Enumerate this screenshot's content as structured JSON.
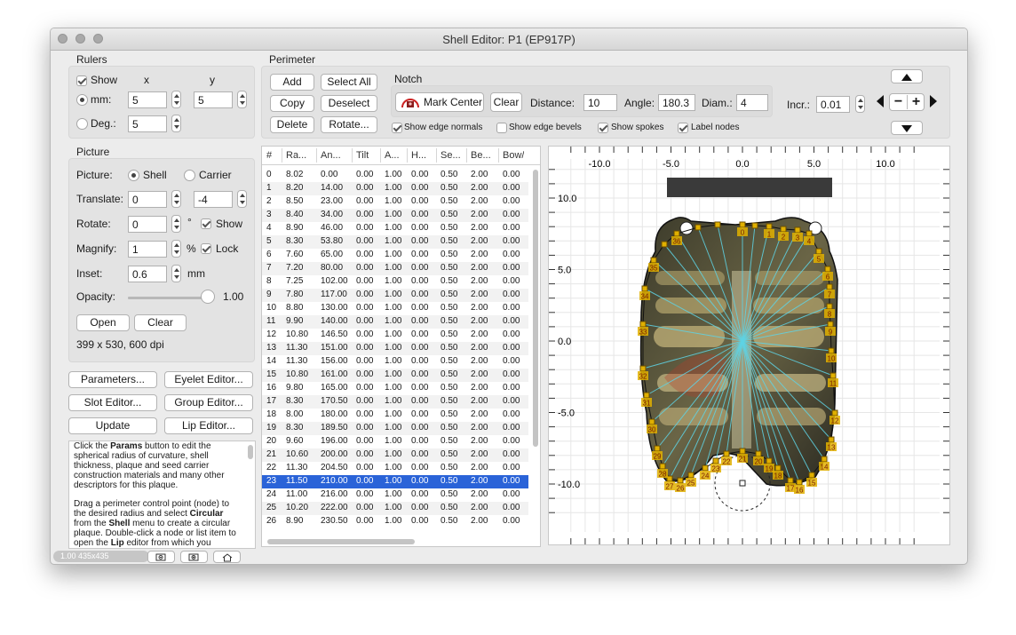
{
  "window": {
    "title": "Shell Editor: P1 (EP917P)"
  },
  "rulers": {
    "section": "Rulers",
    "show_label": "Show",
    "x_header": "x",
    "y_header": "y",
    "mm_label": "mm:",
    "mm_x": "5",
    "mm_y": "5",
    "deg_label": "Deg.:",
    "deg_value": "5"
  },
  "perimeter": {
    "section": "Perimeter",
    "add": "Add",
    "select_all": "Select All",
    "copy": "Copy",
    "deselect": "Deselect",
    "delete": "Delete",
    "rotate": "Rotate...",
    "notch_label": "Notch",
    "mark_center": "Mark Center",
    "clear": "Clear",
    "distance_label": "Distance:",
    "distance": "10",
    "angle_label": "Angle:",
    "angle": "180.3",
    "diam_label": "Diam.:",
    "diam": "4",
    "incr_label": "Incr.:",
    "incr": "0.01",
    "show_edge_normals": "Show edge normals",
    "show_edge_bevels": "Show edge bevels",
    "show_spokes": "Show spokes",
    "label_nodes": "Label nodes"
  },
  "picture": {
    "section": "Picture",
    "picture_label": "Picture:",
    "shell": "Shell",
    "carrier": "Carrier",
    "translate_label": "Translate:",
    "translate_x": "0",
    "translate_y": "-4",
    "rotate_label": "Rotate:",
    "rotate_value": "0",
    "rotate_unit": "°",
    "show_label": "Show",
    "magnify_label": "Magnify:",
    "magnify_value": "1",
    "magnify_unit": "%",
    "lock_label": "Lock",
    "inset_label": "Inset:",
    "inset_value": "0.6",
    "inset_unit": "mm",
    "opacity_label": "Opacity:",
    "opacity_value": "1.00",
    "opacity_level": 1.0,
    "open": "Open",
    "clear": "Clear",
    "info": "399 x 530, 600 dpi"
  },
  "buttons": {
    "parameters": "Parameters...",
    "eyelet_editor": "Eyelet Editor...",
    "slot_editor": "Slot Editor...",
    "group_editor": "Group Editor...",
    "update": "Update",
    "lip_editor": "Lip Editor..."
  },
  "table": {
    "headers": [
      "#",
      "Ra...",
      "An...",
      "Tilt",
      "A...",
      "H...",
      "Se...",
      "Be...",
      "Bow/"
    ],
    "selected_row": 23,
    "rows": [
      [
        "0",
        "8.02",
        "0.00",
        "0.00",
        "1.00",
        "0.00",
        "0.50",
        "2.00",
        "0.00"
      ],
      [
        "1",
        "8.20",
        "14.00",
        "0.00",
        "1.00",
        "0.00",
        "0.50",
        "2.00",
        "0.00"
      ],
      [
        "2",
        "8.50",
        "23.00",
        "0.00",
        "1.00",
        "0.00",
        "0.50",
        "2.00",
        "0.00"
      ],
      [
        "3",
        "8.40",
        "34.00",
        "0.00",
        "1.00",
        "0.00",
        "0.50",
        "2.00",
        "0.00"
      ],
      [
        "4",
        "8.90",
        "46.00",
        "0.00",
        "1.00",
        "0.00",
        "0.50",
        "2.00",
        "0.00"
      ],
      [
        "5",
        "8.30",
        "53.80",
        "0.00",
        "1.00",
        "0.00",
        "0.50",
        "2.00",
        "0.00"
      ],
      [
        "6",
        "7.60",
        "65.00",
        "0.00",
        "1.00",
        "0.00",
        "0.50",
        "2.00",
        "0.00"
      ],
      [
        "7",
        "7.20",
        "80.00",
        "0.00",
        "1.00",
        "0.00",
        "0.50",
        "2.00",
        "0.00"
      ],
      [
        "8",
        "7.25",
        "102.00",
        "0.00",
        "1.00",
        "0.00",
        "0.50",
        "2.00",
        "0.00"
      ],
      [
        "9",
        "7.80",
        "117.00",
        "0.00",
        "1.00",
        "0.00",
        "0.50",
        "2.00",
        "0.00"
      ],
      [
        "10",
        "8.80",
        "130.00",
        "0.00",
        "1.00",
        "0.00",
        "0.50",
        "2.00",
        "0.00"
      ],
      [
        "11",
        "9.90",
        "140.00",
        "0.00",
        "1.00",
        "0.00",
        "0.50",
        "2.00",
        "0.00"
      ],
      [
        "12",
        "10.80",
        "146.50",
        "0.00",
        "1.00",
        "0.00",
        "0.50",
        "2.00",
        "0.00"
      ],
      [
        "13",
        "11.30",
        "151.00",
        "0.00",
        "1.00",
        "0.00",
        "0.50",
        "2.00",
        "0.00"
      ],
      [
        "14",
        "11.30",
        "156.00",
        "0.00",
        "1.00",
        "0.00",
        "0.50",
        "2.00",
        "0.00"
      ],
      [
        "15",
        "10.80",
        "161.00",
        "0.00",
        "1.00",
        "0.00",
        "0.50",
        "2.00",
        "0.00"
      ],
      [
        "16",
        "9.80",
        "165.00",
        "0.00",
        "1.00",
        "0.00",
        "0.50",
        "2.00",
        "0.00"
      ],
      [
        "17",
        "8.30",
        "170.50",
        "0.00",
        "1.00",
        "0.00",
        "0.50",
        "2.00",
        "0.00"
      ],
      [
        "18",
        "8.00",
        "180.00",
        "0.00",
        "1.00",
        "0.00",
        "0.50",
        "2.00",
        "0.00"
      ],
      [
        "19",
        "8.30",
        "189.50",
        "0.00",
        "1.00",
        "0.00",
        "0.50",
        "2.00",
        "0.00"
      ],
      [
        "20",
        "9.60",
        "196.00",
        "0.00",
        "1.00",
        "0.00",
        "0.50",
        "2.00",
        "0.00"
      ],
      [
        "21",
        "10.60",
        "200.00",
        "0.00",
        "1.00",
        "0.00",
        "0.50",
        "2.00",
        "0.00"
      ],
      [
        "22",
        "11.30",
        "204.50",
        "0.00",
        "1.00",
        "0.00",
        "0.50",
        "2.00",
        "0.00"
      ],
      [
        "23",
        "11.50",
        "210.00",
        "0.00",
        "1.00",
        "0.00",
        "0.50",
        "2.00",
        "0.00"
      ],
      [
        "24",
        "11.00",
        "216.00",
        "0.00",
        "1.00",
        "0.00",
        "0.50",
        "2.00",
        "0.00"
      ],
      [
        "25",
        "10.20",
        "222.00",
        "0.00",
        "1.00",
        "0.00",
        "0.50",
        "2.00",
        "0.00"
      ],
      [
        "26",
        "8.90",
        "230.50",
        "0.00",
        "1.00",
        "0.00",
        "0.50",
        "2.00",
        "0.00"
      ]
    ]
  },
  "help": {
    "p1_a": "Click the ",
    "p1_b": "Params",
    "p1_c": " button to edit the spherical radius of curvature, shell thickness, plaque and seed carrier construction materials and many other descriptors for this plaque.",
    "p2_a": "Drag a perimeter control point (node) to the desired radius and select ",
    "p2_b": "Circular",
    "p2_c": " from the ",
    "p2_d": "Shell",
    "p2_e": " menu to create a circular plaque. Double-click a node or list item to open the ",
    "p2_f": "Lip",
    "p2_g": " editor from which you"
  },
  "status": {
    "text": "1.00 435x435"
  },
  "viewer": {
    "x_ticks": [
      "-10.0",
      "-5.0",
      "0.0",
      "5.0",
      "10.0"
    ],
    "y_ticks": [
      "10.0",
      "5.0",
      "0.0",
      "-5.0",
      "-10.0"
    ],
    "node_labels": [
      "0",
      "1",
      "2",
      "3",
      "4",
      "5",
      "6",
      "7",
      "8",
      "9",
      "10",
      "11",
      "12",
      "13",
      "14",
      "15",
      "16",
      "17",
      "18",
      "19",
      "20",
      "21",
      "22",
      "23",
      "24",
      "25",
      "26",
      "27",
      "28",
      "29",
      "30",
      "31",
      "32",
      "33",
      "34",
      "35",
      "36"
    ],
    "accent_node": "#e0b000",
    "accent_select": "#2a63d8"
  }
}
